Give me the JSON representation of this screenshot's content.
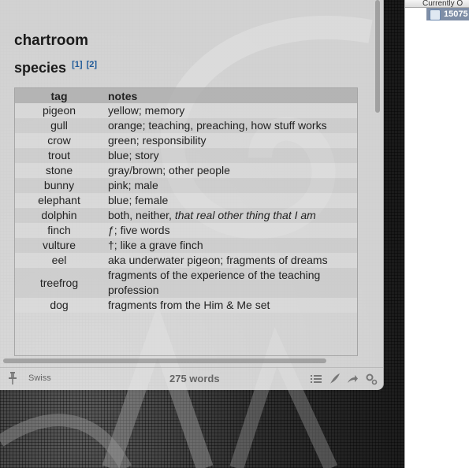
{
  "window": {
    "doc_title": "chartroom",
    "section_title": "species",
    "refs": [
      "[1]",
      "[2]"
    ]
  },
  "table": {
    "headers": [
      "tag",
      "notes"
    ],
    "rows": [
      {
        "tag": "pigeon",
        "notes": "yellow; memory"
      },
      {
        "tag": "gull",
        "notes": "orange; teaching, preaching, how stuff works"
      },
      {
        "tag": "crow",
        "notes": "green; responsibility"
      },
      {
        "tag": "trout",
        "notes": "blue; story"
      },
      {
        "tag": "stone",
        "notes": "gray/brown; other people"
      },
      {
        "tag": "bunny",
        "notes": "pink; male"
      },
      {
        "tag": "elephant",
        "notes": "blue; female"
      },
      {
        "tag": "dolphin",
        "notes_plain": "both, neither, ",
        "notes_italic": "that real other thing that I am"
      },
      {
        "tag": "finch",
        "notes": "ƒ; five words"
      },
      {
        "tag": "vulture",
        "notes": "†; like a grave finch"
      },
      {
        "tag": "eel",
        "notes": "aka underwater pigeon; fragments of dreams"
      },
      {
        "tag": "treefrog",
        "notes": "fragments of the experience of the teaching profession"
      },
      {
        "tag": "dog",
        "notes": "fragments from the Him & Me set"
      }
    ]
  },
  "statusbar": {
    "theme": "Swiss",
    "word_count": "275 words",
    "icons": [
      "pin-icon",
      "list-icon",
      "quill-icon",
      "share-icon",
      "gear-icon"
    ]
  },
  "right_panel": {
    "header": "Currently O",
    "selected_item": "15075"
  },
  "colors": {
    "editor_bg": "#ececec",
    "link": "#1f5a99",
    "selection": "#7f8ea6"
  }
}
